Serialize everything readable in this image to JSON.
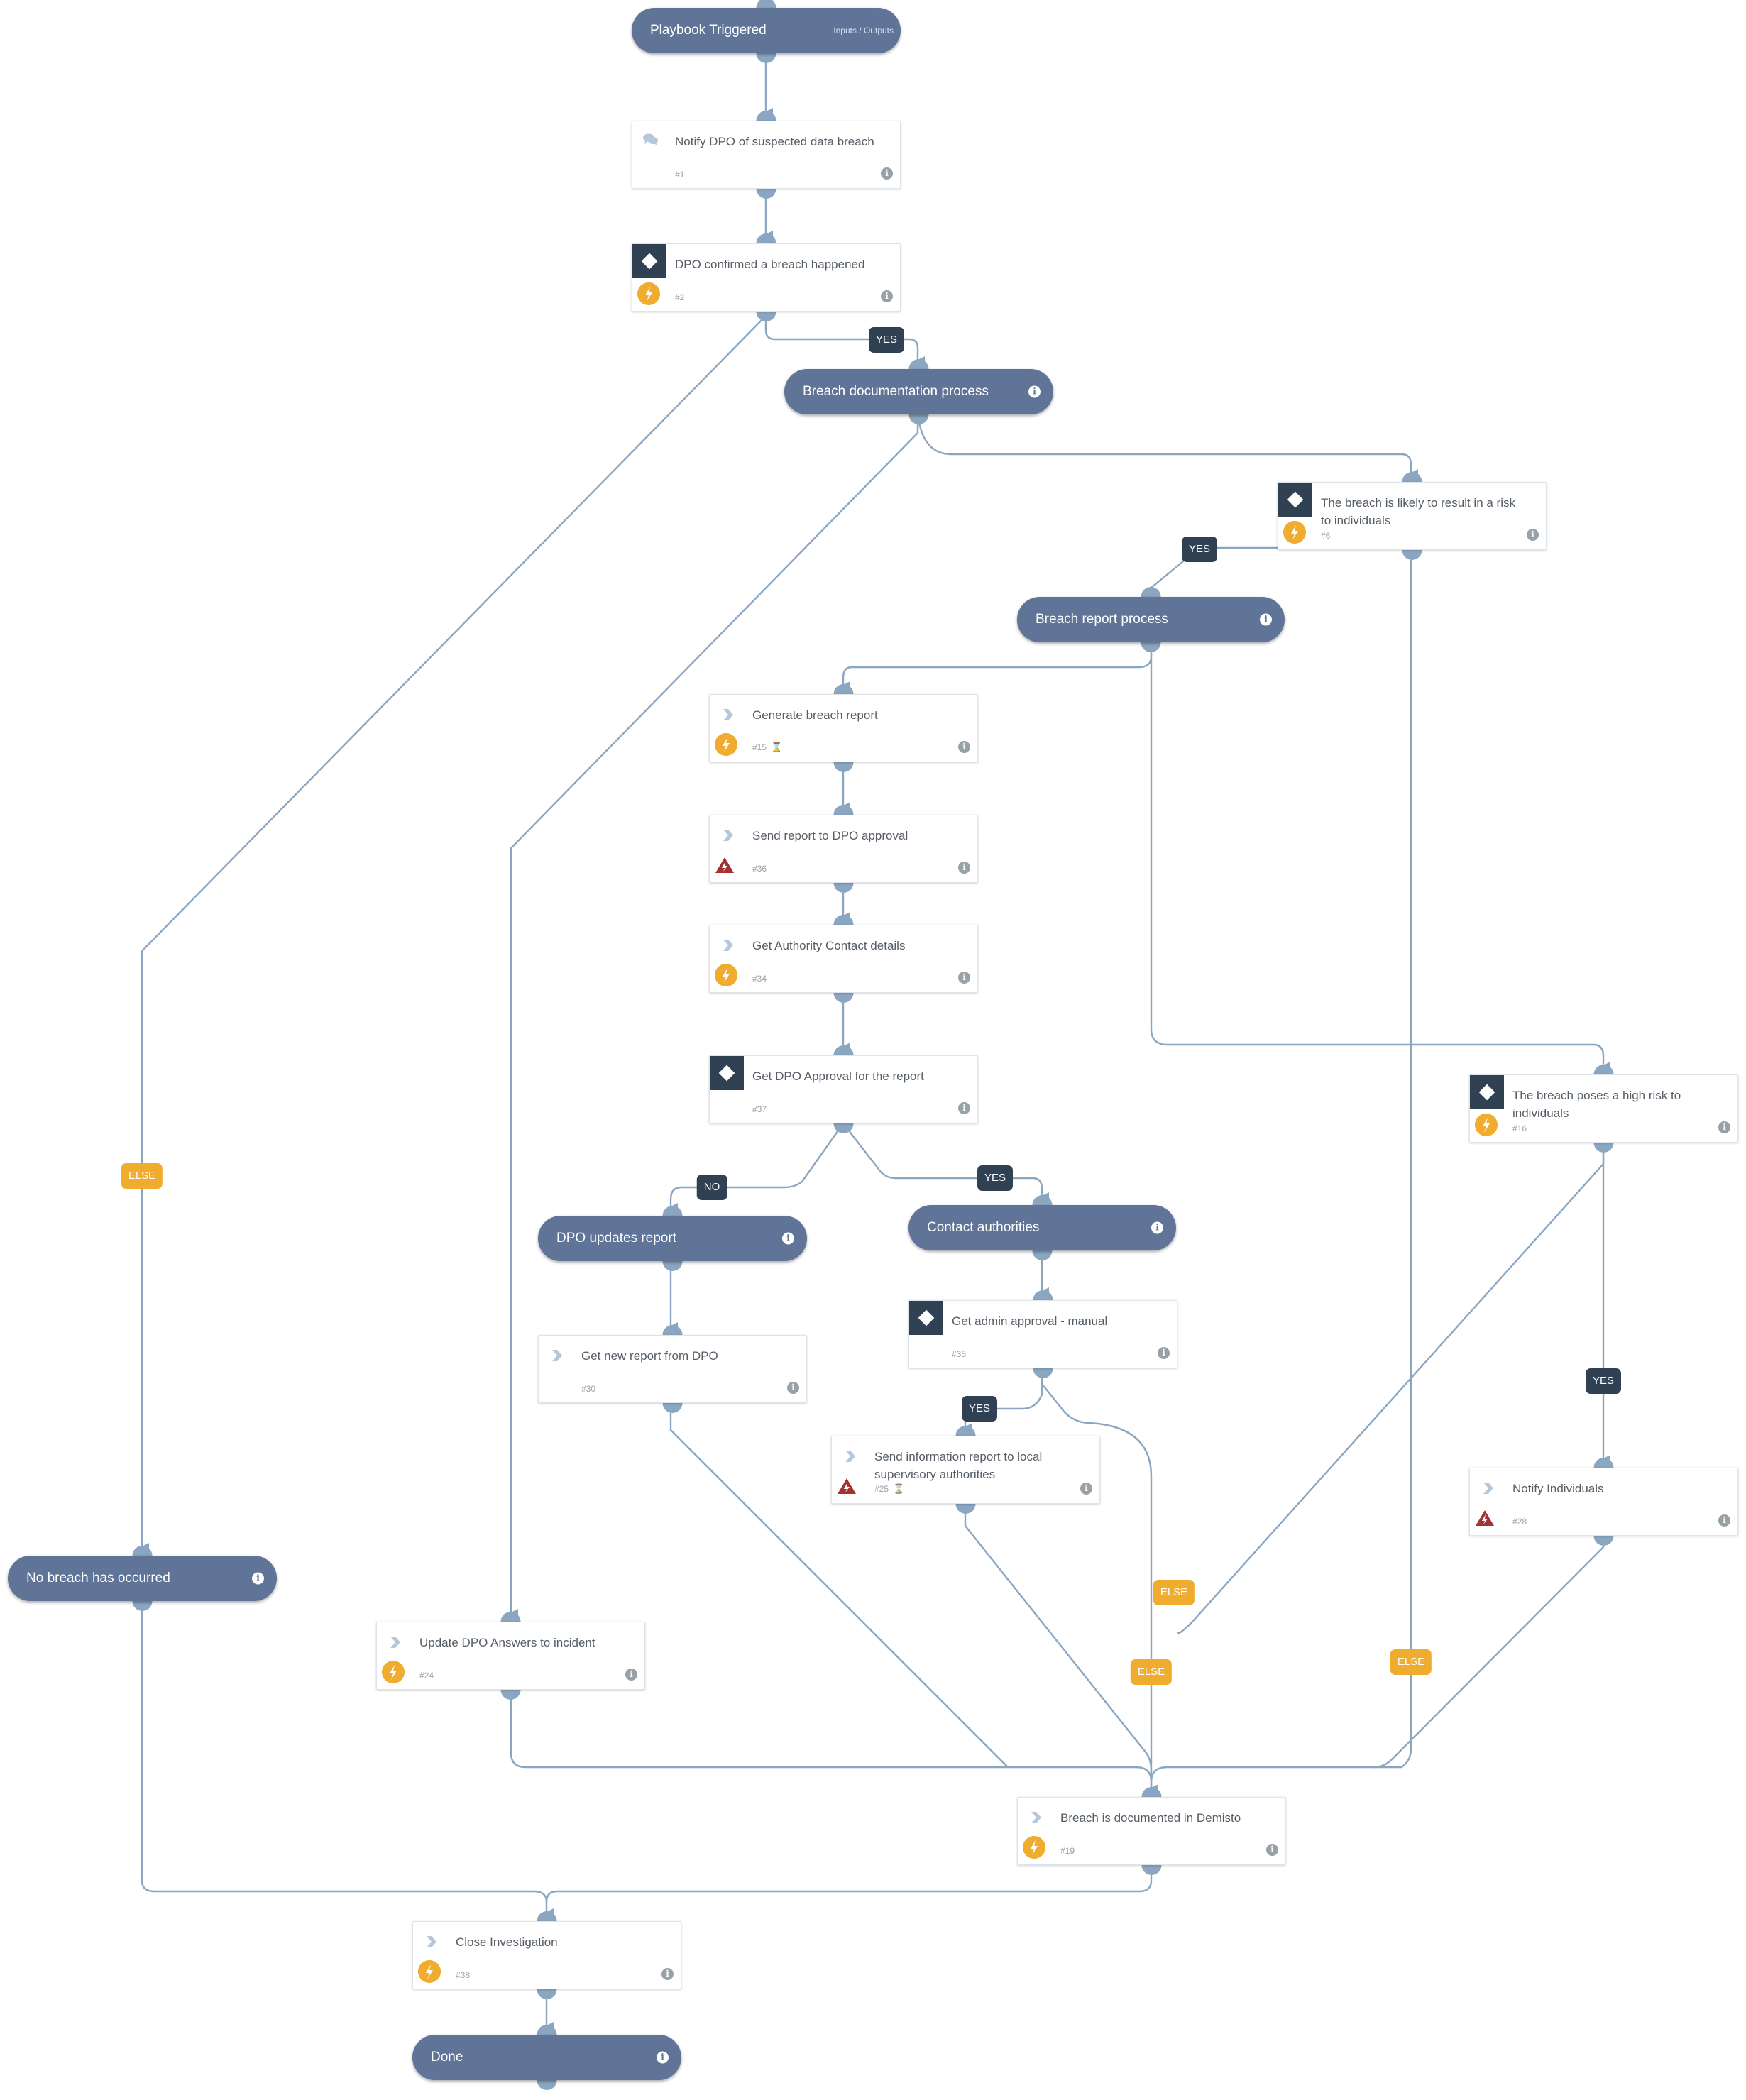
{
  "playbook": {
    "start": {
      "title": "Playbook Triggered",
      "io_link": "Inputs / Outputs"
    },
    "sections": {
      "breach_documentation": "Breach documentation process",
      "breach_report": "Breach report process",
      "dpo_updates": "DPO updates report",
      "contact_authorities": "Contact authorities",
      "no_breach": "No breach has occurred",
      "done": "Done"
    },
    "tasks": {
      "t1": {
        "name": "Notify DPO of suspected data breach",
        "id": "#1",
        "icon": "chat-icon"
      },
      "t2": {
        "name": "DPO confirmed a breach happened",
        "id": "#2",
        "icon": "condition-icon",
        "status": "bolt-icon"
      },
      "t6": {
        "name": "The breach is likely to result in a risk to individuals",
        "id": "#6",
        "icon": "condition-icon",
        "status": "bolt-icon"
      },
      "t15": {
        "name": "Generate breach report",
        "id": "#15",
        "icon": "chevron-icon",
        "status": "bolt-icon",
        "timer": "hourglass-icon"
      },
      "t36": {
        "name": "Send report to DPO approval",
        "id": "#36",
        "icon": "chevron-icon",
        "status": "warning-icon"
      },
      "t34": {
        "name": "Get Authority Contact details",
        "id": "#34",
        "icon": "chevron-icon",
        "status": "bolt-icon"
      },
      "t37": {
        "name": "Get DPO Approval for the report",
        "id": "#37",
        "icon": "condition-icon"
      },
      "t16": {
        "name": "The breach poses a high risk to individuals",
        "id": "#16",
        "icon": "condition-icon",
        "status": "bolt-icon"
      },
      "t35": {
        "name": "Get admin approval - manual",
        "id": "#35",
        "icon": "condition-icon"
      },
      "t30": {
        "name": "Get new report from DPO",
        "id": "#30",
        "icon": "chevron-icon"
      },
      "t25": {
        "name": "Send information report to local supervisory authorities",
        "id": "#25",
        "icon": "chevron-icon",
        "status": "warning-icon",
        "timer": "hourglass-icon"
      },
      "t28": {
        "name": "Notify Individuals",
        "id": "#28",
        "icon": "chevron-icon",
        "status": "warning-icon"
      },
      "t24": {
        "name": "Update DPO Answers to incident",
        "id": "#24",
        "icon": "chevron-icon",
        "status": "bolt-icon"
      },
      "t19": {
        "name": "Breach is documented in Demisto",
        "id": "#19",
        "icon": "chevron-icon",
        "status": "bolt-icon"
      },
      "t38": {
        "name": "Close Investigation",
        "id": "#38",
        "icon": "chevron-icon",
        "status": "bolt-icon"
      }
    },
    "edge_labels": {
      "yes": "YES",
      "no": "NO",
      "else": "ELSE"
    },
    "info_glyph": "i",
    "hourglass_glyph": "⌛",
    "colors": {
      "section": "#5f7497",
      "condition": "#2f4153",
      "bolt": "#f0ac2e",
      "warning": "#a33232",
      "edge": "#8aa6c1",
      "else_label": "#f0ac2e"
    }
  }
}
